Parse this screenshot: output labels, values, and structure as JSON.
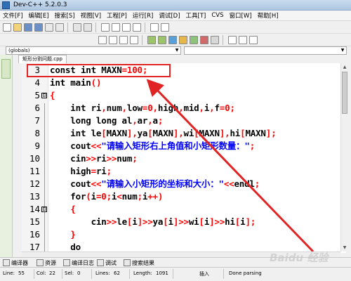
{
  "window": {
    "title": "Dev-C++ 5.2.0.3"
  },
  "menu": [
    "文件[F]",
    "编辑[E]",
    "搜索[S]",
    "视图[V]",
    "工程[P]",
    "运行[R]",
    "调试[D]",
    "工具[T]",
    "CVS",
    "窗口[W]",
    "帮助[H]"
  ],
  "scope_combo": {
    "value": "(globals)"
  },
  "file_tab": {
    "label": "矩形分割问题.cpp"
  },
  "code_lines": [
    {
      "no": "3",
      "fold": "",
      "text": "const int MAXN=100;"
    },
    {
      "no": "4",
      "fold": "",
      "text": "int main()"
    },
    {
      "no": "5",
      "fold": "⊟",
      "text": "{"
    },
    {
      "no": "6",
      "fold": "",
      "text": "    int ri,num,low=0,high,mid,i,f=0;"
    },
    {
      "no": "7",
      "fold": "",
      "text": "    long long al,ar,a;"
    },
    {
      "no": "8",
      "fold": "",
      "text": "    int le[MAXN],ya[MAXN],wi[MAXN],hi[MAXN];"
    },
    {
      "no": "9",
      "fold": "",
      "text": "    cout<<\"请输入矩形右上角值和小矩形数量：\";"
    },
    {
      "no": "10",
      "fold": "",
      "text": "    cin>>ri>>num;"
    },
    {
      "no": "11",
      "fold": "",
      "text": "    high=ri;"
    },
    {
      "no": "12",
      "fold": "",
      "text": "    cout<<\"请输入小矩形的坐标和大小：\"<<endl;"
    },
    {
      "no": "13",
      "fold": "",
      "text": "    for(i=0;i<num;i++)"
    },
    {
      "no": "14",
      "fold": "⊟",
      "text": "    {"
    },
    {
      "no": "15",
      "fold": "",
      "text": "        cin>>le[i]>>ya[i]>>wi[i]>>hi[i];"
    },
    {
      "no": "16",
      "fold": "",
      "text": "    }"
    },
    {
      "no": "17",
      "fold": "",
      "text": "    do"
    }
  ],
  "bottom_tabs": [
    "编译器",
    "资源",
    "编译日志",
    "调试",
    "搜索结果"
  ],
  "status": {
    "line_label": "Line:",
    "line_value": "55",
    "col_label": "Col:",
    "col_value": "22",
    "sel_label": "Sel:",
    "sel_value": "0",
    "lines_label": "Lines:",
    "lines_value": "62",
    "length_label": "Length:",
    "length_value": "1091",
    "mode": "插入",
    "message": "Done parsing"
  },
  "watermark": {
    "text": "Baidu 经验"
  },
  "colors": {
    "keyword": "#000000",
    "string": "#0000ff",
    "number": "#ff0000",
    "symbol": "#ff0000",
    "annotation": "#e02424"
  }
}
